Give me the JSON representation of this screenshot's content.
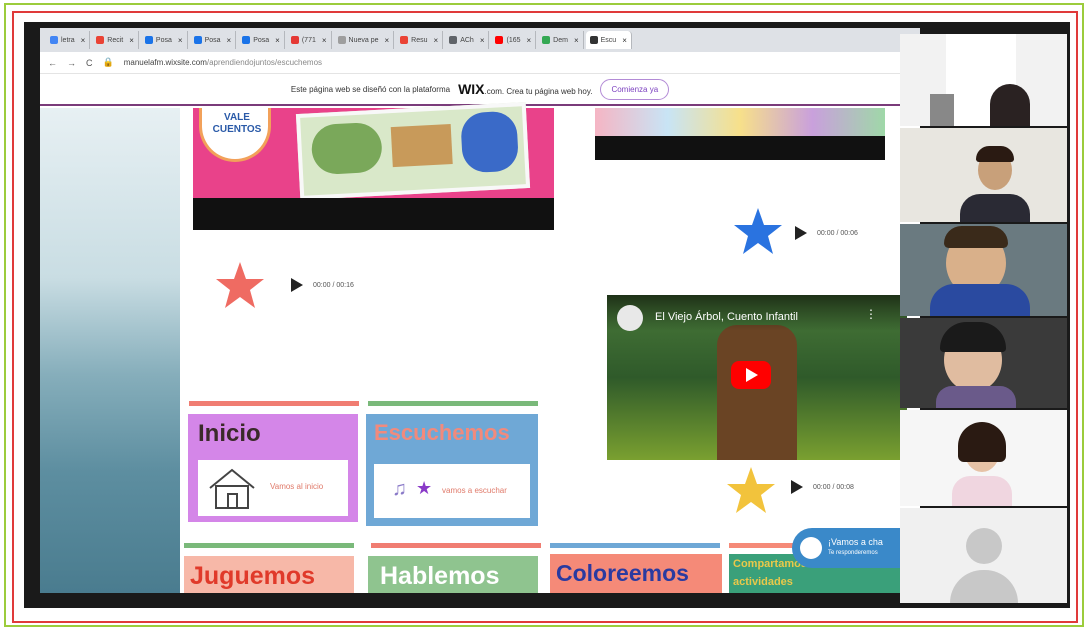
{
  "browser": {
    "tabs": [
      {
        "label": "letra",
        "color": "#4285f4"
      },
      {
        "label": "Recit",
        "color": "#ea4335"
      },
      {
        "label": "Posa",
        "color": "#1a73e8"
      },
      {
        "label": "Posa",
        "color": "#1a73e8"
      },
      {
        "label": "Posa",
        "color": "#1a73e8"
      },
      {
        "label": "(771",
        "color": "#e53935"
      },
      {
        "label": "Nueva pe",
        "color": "#9e9e9e"
      },
      {
        "label": "Resu",
        "color": "#ea4335"
      },
      {
        "label": "ACh",
        "color": "#5f6368"
      },
      {
        "label": "(165",
        "color": "#ff0000"
      },
      {
        "label": "Dem",
        "color": "#34a853"
      },
      {
        "label": "Escu",
        "color": "#333333"
      }
    ],
    "url_domain": "manuelafm.wixsite.com",
    "url_path": "/aprendiendojuntos/escuchemos"
  },
  "wix_banner": {
    "text_before": "Este página web se diseñó con la plataforma",
    "brand": "WIX",
    "text_after": ".com. Crea tu página web hoy.",
    "button": "Comienza ya"
  },
  "page": {
    "logo_text": "VALE\nCUENTOS",
    "audio_players": [
      {
        "time": "00:00 / 00:16",
        "star_color": "#ef6b62"
      },
      {
        "time": "00:00 / 00:06",
        "star_color": "#2a73e0"
      },
      {
        "time": "00:00 / 00:08",
        "star_color": "#f2c33c"
      }
    ],
    "video": {
      "title": "El Viejo Árbol, Cuento Infantil"
    },
    "menu_cards": [
      {
        "title": "Inicio",
        "sub": "Vamos al inicio",
        "bg": "#d486e8",
        "title_color": "#3a2a2a",
        "bar": "#f07d72"
      },
      {
        "title": "Escuchemos",
        "sub": "vamos a escuchar",
        "bg": "#6fa8d6",
        "title_color": "#f28a7c",
        "bar": "#7ab97a"
      },
      {
        "title": "Juguemos",
        "bg": "#f7b8a8",
        "title_color": "#e03a2a",
        "bar": "#7ab97a"
      },
      {
        "title": "Hablemos",
        "bg": "#8fc48f",
        "title_color": "#ffffff",
        "bar": "#f07d72"
      },
      {
        "title": "Coloreemos",
        "bg": "#f58a78",
        "title_color": "#2a3aa0",
        "bar": "#6fa8d6"
      },
      {
        "title": "Compartamos",
        "title_line2": "actividades",
        "bg": "#3aa07a",
        "title_color": "#e9c84a",
        "bar": "#f58a78"
      }
    ],
    "chat": {
      "text": "¡Vamos a cha",
      "sub": "Te responderemos"
    }
  },
  "colors": {
    "green_frame": "#9ccc3c",
    "red_frame": "#e03a3a",
    "wix_accent": "#7b3fbf"
  }
}
